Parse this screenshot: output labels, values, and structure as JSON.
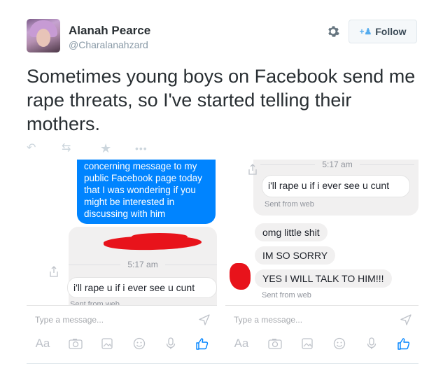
{
  "tweet": {
    "author_name": "Alanah Pearce",
    "author_handle": "@Charalanahzard",
    "follow_label": "Follow",
    "text": "Sometimes young boys on Facebook send me rape threats, so I've started telling their mothers."
  },
  "left_panel": {
    "blue_message": "concerning message to my public Facebook page today that I was wondering if you might be interested in discussing with him",
    "time": "5:17 am",
    "message": "i'll rape u if i ever see u cunt",
    "sent_from": "Sent from web"
  },
  "right_panel": {
    "time": "5:17 am",
    "message": "i'll rape u if i ever see u cunt",
    "sent_from": "Sent from web",
    "replies": [
      "omg little shit",
      "IM SO SORRY",
      "YES I WILL TALK TO HIM!!!"
    ],
    "reply_sent_from": "Sent from web"
  },
  "composer": {
    "placeholder": "Type a message...",
    "format_label": "Aa"
  },
  "icons": [
    "gear-icon",
    "follow-person-icon",
    "reply-icon",
    "retweet-icon",
    "like-star-icon",
    "more-icon",
    "share-icon",
    "send-icon",
    "camera-icon",
    "gallery-icon",
    "sticker-icon",
    "mic-icon",
    "thumbs-up-icon"
  ],
  "colors": {
    "messenger_blue": "#0084ff",
    "twitter_blue": "#55acee",
    "redaction_red": "#e8131b"
  }
}
